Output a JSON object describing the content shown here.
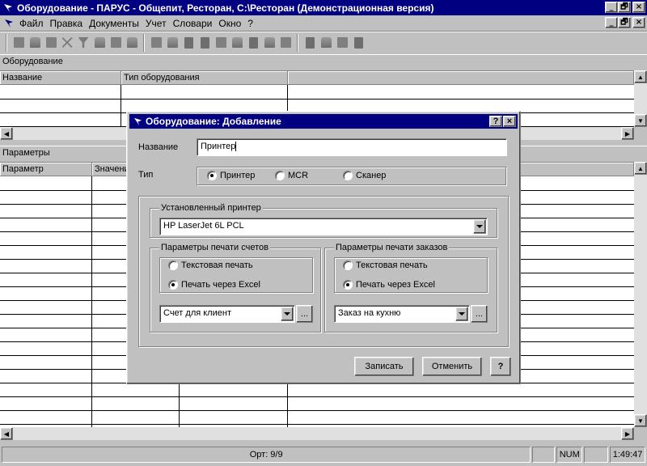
{
  "window": {
    "title": "Оборудование - ПАРУС - Общепит, Ресторан, C:\\Ресторан (Демонстрационная версия)",
    "minimize": "_",
    "restore": "🗗",
    "close": "×"
  },
  "menu": {
    "items": [
      "Файл",
      "Правка",
      "Документы",
      "Учет",
      "Словари",
      "Окно",
      "?"
    ]
  },
  "equipment_panel": {
    "header": "Оборудование",
    "columns": [
      "Название",
      "Тип оборудования"
    ]
  },
  "params_panel": {
    "header": "Параметры",
    "columns": [
      "Параметр",
      "Значение"
    ]
  },
  "status": {
    "sort": "Орт: 9/9",
    "num": "NUM",
    "time": "1:49:47"
  },
  "dialog": {
    "title": "Оборудование: Добавление",
    "help_caption": "?",
    "close_caption": "×",
    "name_label": "Название",
    "name_value": "Принтер",
    "type_label": "Тип",
    "type_options": [
      "Принтер",
      "MCR",
      "Сканер"
    ],
    "type_selected": 0,
    "printer_group": "Установленный принтер",
    "printer_value": "HP LaserJet 6L PCL",
    "bills_group": "Параметры печати счетов",
    "bills_options": [
      "Текстовая печать",
      "Печать через Excel"
    ],
    "bills_selected": 1,
    "bills_template": "Счет для клиент",
    "orders_group": "Параметры печати заказов",
    "orders_options": [
      "Текстовая печать",
      "Печать через Excel"
    ],
    "orders_selected": 1,
    "orders_template": "Заказ на кухню",
    "browse_label": "...",
    "save_label": "Записать",
    "cancel_label": "Отменить",
    "help_label": "?"
  },
  "colors": {
    "title_bar": "#000080",
    "face": "#c0c0c0",
    "window": "#ffffff"
  }
}
